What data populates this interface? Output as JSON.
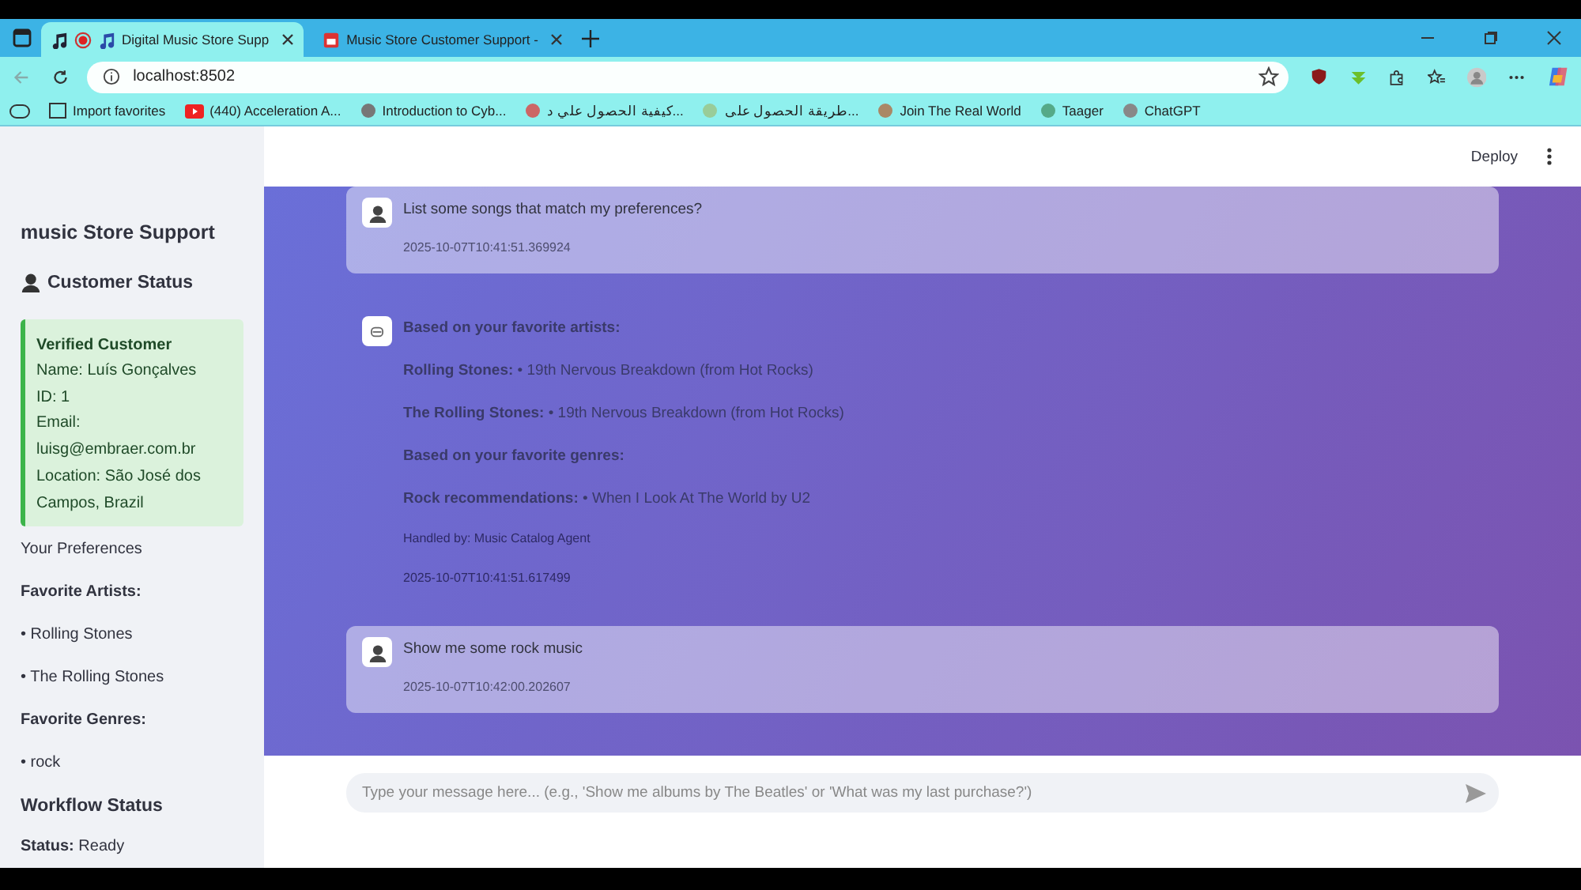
{
  "browser": {
    "tabs": [
      {
        "title": "Digital Music Store Supp",
        "selected": true
      },
      {
        "title": "Music Store Customer Support -",
        "selected": false
      }
    ],
    "address": "localhost:8502",
    "bookmarks": [
      "Import favorites",
      "(440) Acceleration A...",
      "Introduction to Cyb...",
      "كيفية الحصول علي د...",
      "طريقة الحصول على...",
      "Join The Real World",
      "Taager",
      "ChatGPT"
    ]
  },
  "sidebar": {
    "title": "music Store Support",
    "status_heading": "Customer Status",
    "customer_card": {
      "title": "Verified Customer",
      "lines": [
        "Name: Luís Gonçalves",
        "ID: 1",
        "Email:",
        "luisg@embraer.com.br",
        "Location: São José dos",
        "Campos, Brazil"
      ]
    },
    "preferences_label": "Your Preferences",
    "artists_heading": "Favorite Artists:",
    "artists": [
      "• Rolling Stones",
      "• The Rolling Stones"
    ],
    "genres_heading": "Favorite Genres:",
    "genres": [
      "• rock"
    ],
    "workflow_heading": "Workflow Status",
    "workflow_status": "**Status:** Ready"
  },
  "header": {
    "deploy": "Deploy"
  },
  "messages": [
    {
      "kind": "user",
      "lines": [
        "List some songs that match my preferences?"
      ],
      "timestamp": "2025-10-07T10:41:51.369924"
    },
    {
      "kind": "assistant",
      "lines": [
        "**Based on your favorite artists:**",
        "**Rolling Stones:** • 19th Nervous Breakdown (from Hot Rocks)",
        "**The Rolling Stones:** • 19th Nervous Breakdown (from Hot Rocks)",
        "**Based on your favorite genres:**",
        "**Rock recommendations:** • When I Look At The World by U2"
      ],
      "handled_by": "Handled by: Music Catalog Agent",
      "timestamp": "2025-10-07T10:41:51.617499"
    },
    {
      "kind": "user",
      "lines": [
        "Show me some rock music"
      ],
      "timestamp": "2025-10-07T10:42:00.202607"
    }
  ],
  "chat_input": {
    "placeholder": "Type your message here... (e.g., 'Show me albums by The Beatles' or 'What was my last purchase?')"
  }
}
